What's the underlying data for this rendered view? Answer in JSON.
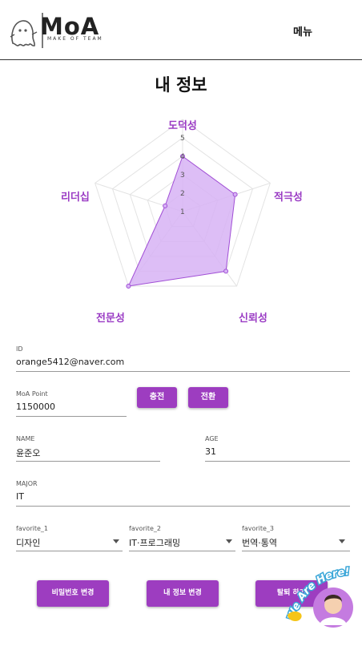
{
  "header": {
    "logo_text": "MoA",
    "logo_sub": "MAKE OF TEAM",
    "menu_label": "메뉴"
  },
  "page": {
    "title": "내 정보"
  },
  "chart_data": {
    "type": "radar",
    "axes": [
      "도덕성",
      "적극성",
      "신뢰성",
      "전문성",
      "리더십"
    ],
    "values": [
      3,
      3,
      4,
      5,
      1
    ],
    "range": [
      0,
      5
    ],
    "ticks": [
      "1",
      "2",
      "3",
      "4",
      "5"
    ],
    "fill_color": "#d7b3f5",
    "stroke_color": "#a14fd6",
    "label_color": "#9a3bc4"
  },
  "profile": {
    "id_label": "ID",
    "id_value": "orange5412@naver.com",
    "point_label": "MoA Point",
    "point_value": "1150000",
    "charge_button": "충전",
    "convert_button": "전환",
    "name_label": "NAME",
    "name_value": "윤준오",
    "age_label": "AGE",
    "age_value": "31",
    "major_label": "MAJOR",
    "major_value": "IT",
    "favorite1_label": "favorite_1",
    "favorite1_value": "디자인",
    "favorite2_label": "favorite_2",
    "favorite2_value": "IT·프로그래밍",
    "favorite3_label": "favorite_3",
    "favorite3_value": "번역·통역"
  },
  "actions": {
    "change_password": "비밀번호 변경",
    "edit_info": "내 정보 변경",
    "withdraw": "탈퇴 하기"
  },
  "floating": {
    "text": "We Are Here!"
  },
  "colors": {
    "accent": "#9d3dc0"
  }
}
